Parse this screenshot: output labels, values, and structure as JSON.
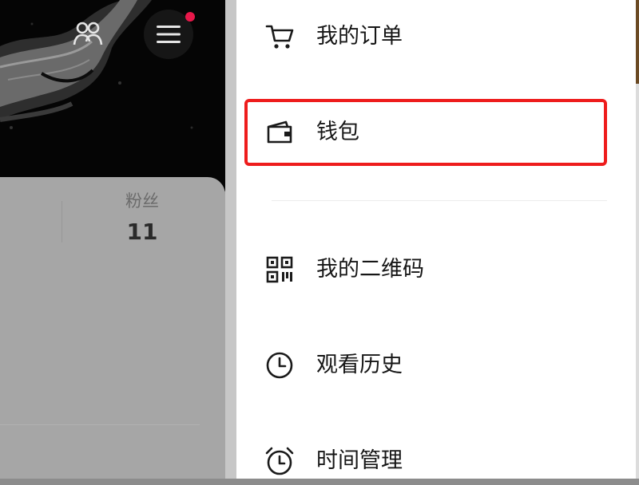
{
  "profile": {
    "stats": [
      {
        "label": "粉丝",
        "value": "11"
      }
    ],
    "notification_badge_color": "#e8184a"
  },
  "drawer": {
    "items": [
      {
        "label": "我的订单",
        "icon": "cart-icon"
      },
      {
        "label": "钱包",
        "icon": "wallet-icon"
      },
      {
        "label": "我的二维码",
        "icon": "qrcode-icon"
      },
      {
        "label": "观看历史",
        "icon": "clock-icon"
      },
      {
        "label": "时间管理",
        "icon": "alarm-clock-icon"
      }
    ],
    "highlighted_item": "钱包",
    "highlight_color": "#ee1c1c"
  }
}
